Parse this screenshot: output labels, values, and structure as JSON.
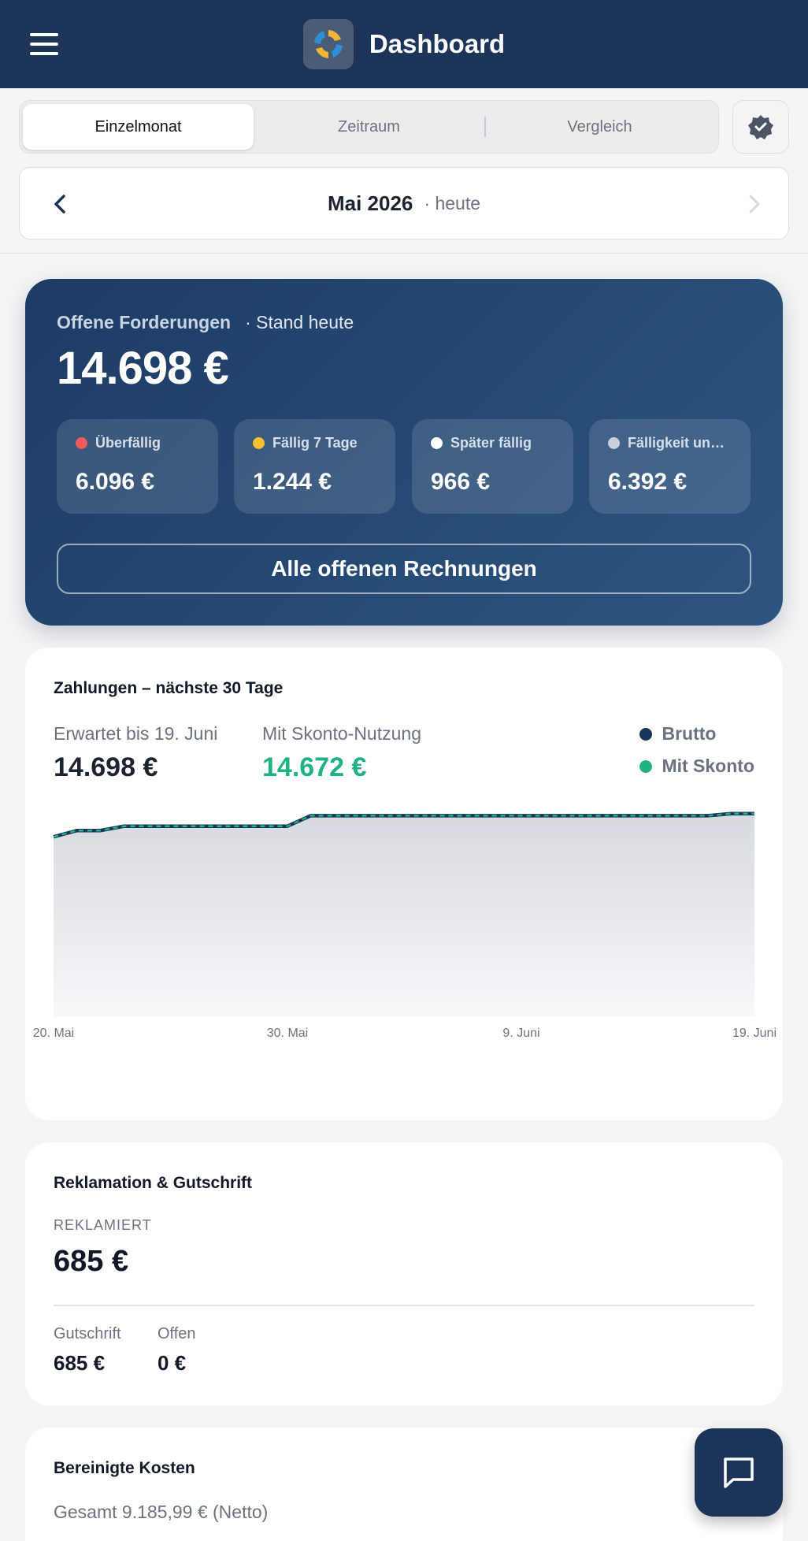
{
  "header": {
    "title": "Dashboard",
    "menu_icon": "hamburger-icon",
    "logo_icon": "app-logo-icon"
  },
  "tabs": [
    {
      "label": "Einzelmonat",
      "active": true
    },
    {
      "label": "Zeitraum",
      "active": false
    },
    {
      "label": "Vergleich",
      "active": false
    }
  ],
  "badge_icon": "verified-badge-icon",
  "month_nav": {
    "title": "Mai 2026",
    "sub": "· heute",
    "prev_icon": "chevron-left-icon",
    "next_icon": "chevron-right-icon"
  },
  "receivables": {
    "label": "Offene Forderungen",
    "sub": "· Stand heute",
    "amount": "14.698 €",
    "tiles": [
      {
        "label": "Überfällig",
        "value": "6.096 €",
        "color": "#f05a5a"
      },
      {
        "label": "Fällig 7 Tage",
        "value": "1.244 €",
        "color": "#f2c230"
      },
      {
        "label": "Später fällig",
        "value": "966 €",
        "color": "#ffffff"
      },
      {
        "label": "Fälligkeit unk…",
        "value": "6.392 €",
        "color": "#c9d0da"
      }
    ],
    "button": "Alle offenen Rechnungen"
  },
  "payments": {
    "title": "Zahlungen – nächste 30 Tage",
    "expected_label": "Erwartet bis 19. Juni",
    "expected_value": "14.698 €",
    "skonto_label": "Mit Skonto-Nutzung",
    "skonto_value": "14.672 €"
  },
  "chart_data": {
    "type": "area",
    "x_ticks": [
      "20. Mai",
      "30. Mai",
      "9. Juni",
      "19. Juni"
    ],
    "grid": true,
    "legend_position": "top-right",
    "series": [
      {
        "name": "Brutto",
        "color": "#1b3457"
      },
      {
        "name": "Mit Skonto",
        "color": "#1fb384"
      }
    ],
    "x": [
      0,
      1,
      2,
      3,
      4,
      5,
      6,
      7,
      8,
      9,
      10,
      11,
      12,
      13,
      14,
      15,
      16,
      17,
      18,
      19,
      20,
      21,
      22,
      23,
      24,
      25,
      26,
      27,
      28,
      29,
      30
    ],
    "values": [
      0.85,
      0.88,
      0.88,
      0.9,
      0.9,
      0.9,
      0.9,
      0.9,
      0.9,
      0.9,
      0.9,
      0.95,
      0.95,
      0.95,
      0.95,
      0.95,
      0.95,
      0.95,
      0.95,
      0.95,
      0.95,
      0.95,
      0.95,
      0.95,
      0.95,
      0.95,
      0.95,
      0.95,
      0.95,
      0.96,
      0.96
    ]
  },
  "complaint": {
    "title": "Reklamation & Gutschrift",
    "label": "REKLAMIERT",
    "amount": "685 €",
    "credit_label": "Gutschrift",
    "credit_value": "685 €",
    "open_label": "Offen",
    "open_value": "0 €"
  },
  "costs": {
    "title": "Bereinigte Kosten",
    "sub": "Gesamt 9.185,99 € (Netto)"
  },
  "fab_icon": "chat-icon"
}
